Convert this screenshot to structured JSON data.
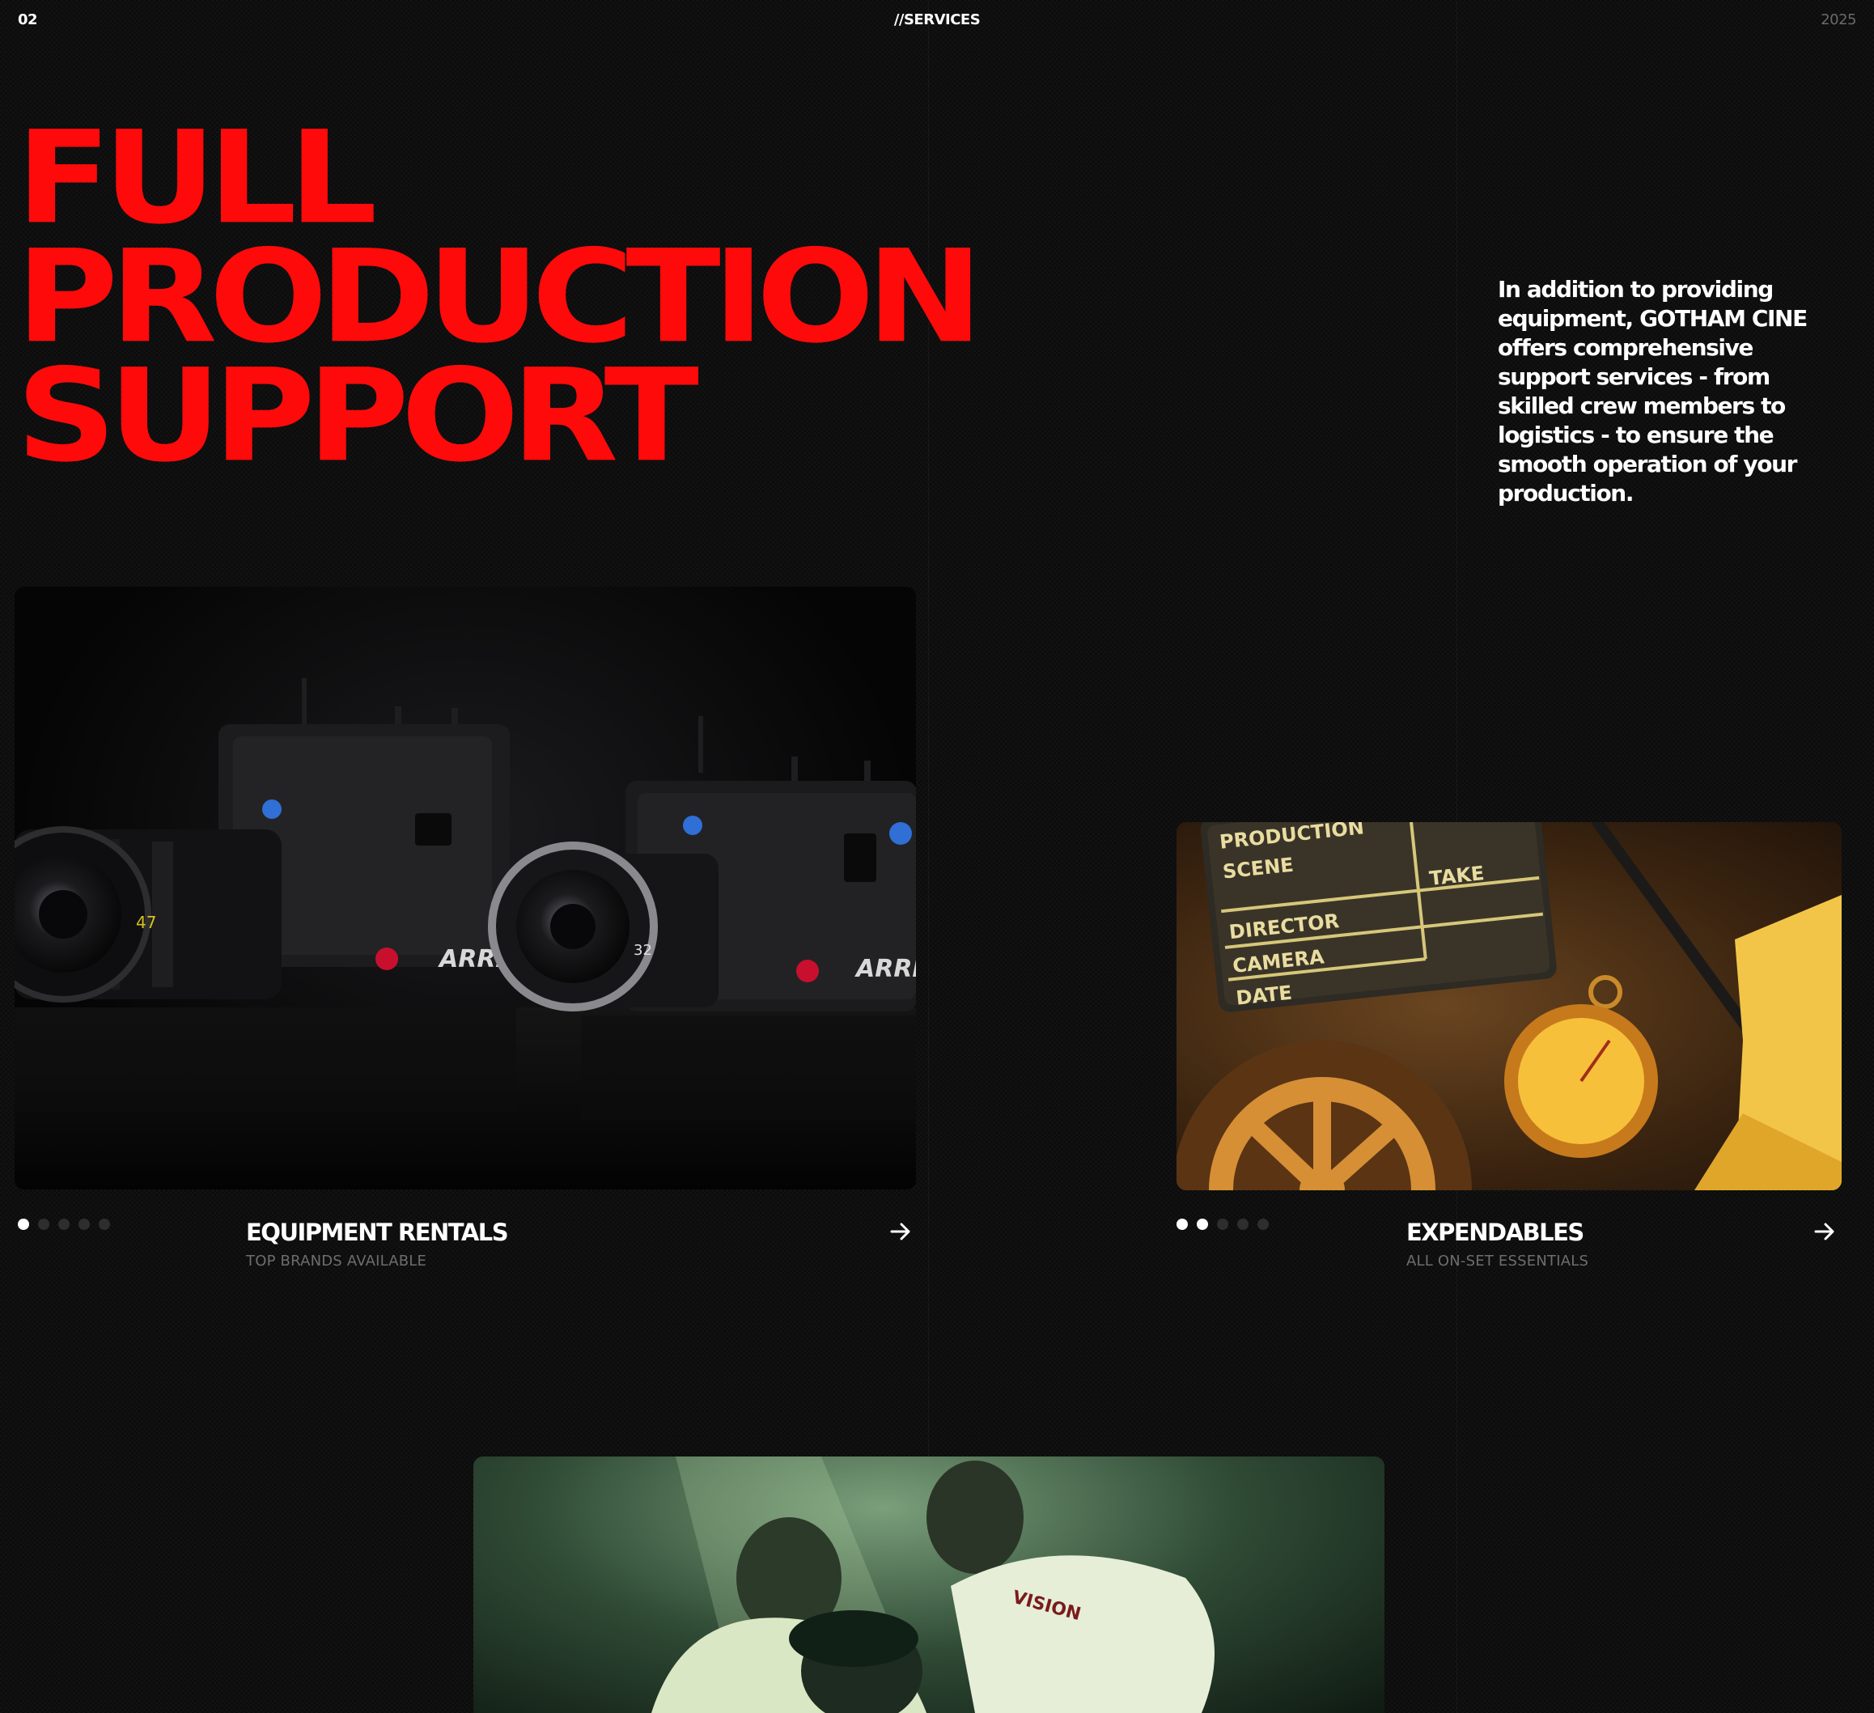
{
  "header": {
    "page_number": "02",
    "section": "//SERVICES",
    "year": "2025"
  },
  "hero": {
    "headline_lines": [
      "FULL",
      "PRODUCTION",
      "SUPPORT"
    ],
    "intro": "In addition to providing equipment, GOTHAM CINE offers comprehensive support services - from skilled crew members to logistics - to ensure the smooth operation of your production."
  },
  "cards": [
    {
      "title": "EQUIPMENT RENTALS",
      "subtitle": "TOP BRANDS AVAILABLE",
      "image_alt": "Two ARRI cinema cameras with lenses",
      "camera_brand": "ARRI",
      "slide_active": 1,
      "slide_count": 5
    },
    {
      "title": "EXPENDABLES",
      "subtitle": "ALL ON-SET ESSENTIALS",
      "image_alt": "Film clapperboard, stopwatch and film reel",
      "slate": {
        "production": "PRODUCTION",
        "scene": "SCENE",
        "take": "TAKE",
        "director": "DIRECTOR",
        "camera": "CAMERA",
        "date": "DATE"
      },
      "slide_active": 2,
      "slide_count": 5
    },
    {
      "image_alt": "Film crew gathered around a monitor"
    }
  ],
  "colors": {
    "accent": "#ff0a0a",
    "background": "#0c0c0c",
    "muted": "#6d6d6d"
  },
  "icons": {
    "card_link": "arrow-right-icon"
  }
}
